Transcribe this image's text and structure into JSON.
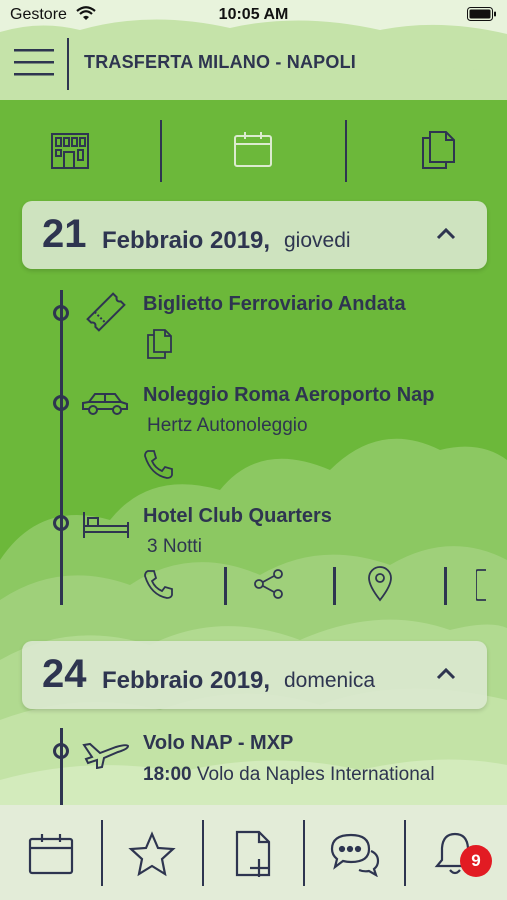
{
  "status_bar": {
    "carrier": "Gestore",
    "time": "10:05 AM"
  },
  "header": {
    "title": "TRASFERTA MILANO - NAPOLI"
  },
  "tabs": [
    {
      "icon": "building-icon",
      "active": true
    },
    {
      "icon": "calendar-icon",
      "active": false
    },
    {
      "icon": "documents-icon",
      "active": true
    }
  ],
  "days": [
    {
      "day_num": "21",
      "month": "Febbraio 2019,",
      "weekday": "giovedi",
      "items": [
        {
          "icon": "ticket-icon",
          "title": "Biglietto Ferroviario Andata",
          "actions": [
            "documents-icon"
          ]
        },
        {
          "icon": "car-icon",
          "title": "Noleggio Roma Aeroporto Nap",
          "subtitle": "Hertz Autonoleggio",
          "actions": [
            "phone-icon"
          ]
        },
        {
          "icon": "bed-icon",
          "title": "Hotel  Club Quarters",
          "subtitle": "3 Notti",
          "actions": [
            "phone-icon",
            "share-icon",
            "location-pin-icon",
            "more-icon"
          ]
        }
      ]
    },
    {
      "day_num": "24",
      "month": "Febbraio 2019,",
      "weekday": "domenica",
      "items": [
        {
          "icon": "airplane-icon",
          "title": "Volo NAP - MXP",
          "subtitle_time": "18:00",
          "subtitle": "Volo da Naples International"
        }
      ]
    }
  ],
  "bottom_bar": {
    "buttons": [
      "calendar-icon",
      "star-icon",
      "add-document-icon",
      "chat-icon",
      "bell-icon"
    ],
    "notification_count": "9"
  },
  "colors": {
    "background": "#6cb83a",
    "clouds": "#9fd07a",
    "text": "#2e3550",
    "card": "#dce8d2",
    "bottom_bar": "#e3ecd8",
    "badge": "#e21b23"
  }
}
